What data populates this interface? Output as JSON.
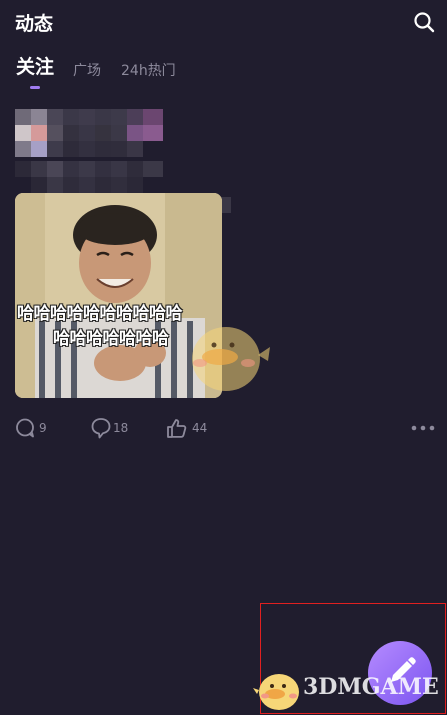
{
  "header": {
    "title": "动态",
    "search_icon": "search-icon"
  },
  "tabs": [
    {
      "label": "关注",
      "active": true
    },
    {
      "label": "广场",
      "active": false
    },
    {
      "label": "24h热门",
      "active": false
    }
  ],
  "colors": {
    "background": "#201d2e",
    "accent": "#a07cf0",
    "muted_text": "#8d8a9c",
    "fab_gradient_start": "#b58bff",
    "fab_gradient_end": "#7c55f0",
    "highlight_border": "#e02020"
  },
  "post": {
    "image_overlay_lines": [
      "哈哈哈哈哈哈哈哈哈哈",
      "哈哈哈哈哈哈哈"
    ],
    "actions": {
      "comments": {
        "icon": "comment-icon",
        "count": "9"
      },
      "shares": {
        "icon": "bubble-icon",
        "count": "18"
      },
      "likes": {
        "icon": "thumbs-up-icon",
        "count": "44"
      },
      "more_icon": "more-dots-icon"
    }
  },
  "fab": {
    "icon": "pencil-icon"
  },
  "watermark": {
    "text": "3DMGAME",
    "icon": "chick-mascot-icon"
  }
}
